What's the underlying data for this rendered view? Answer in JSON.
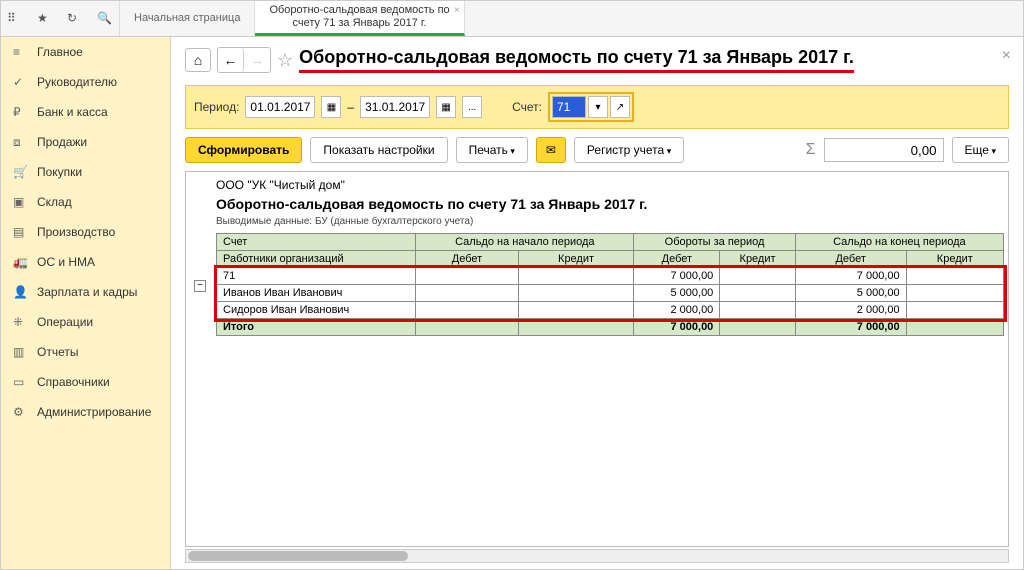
{
  "tabs": [
    {
      "label": "Начальная страница",
      "active": false
    },
    {
      "label1": "Оборотно-сальдовая ведомость по",
      "label2": "счету 71 за Январь 2017 г.",
      "active": true
    }
  ],
  "sidebar": [
    {
      "label": "Главное",
      "icon": "menu-icon"
    },
    {
      "label": "Руководителю",
      "icon": "chart-icon"
    },
    {
      "label": "Банк и касса",
      "icon": "ruble-icon"
    },
    {
      "label": "Продажи",
      "icon": "bag-icon"
    },
    {
      "label": "Покупки",
      "icon": "cart-icon"
    },
    {
      "label": "Склад",
      "icon": "box-icon"
    },
    {
      "label": "Производство",
      "icon": "factory-icon"
    },
    {
      "label": "ОС и НМА",
      "icon": "truck-icon"
    },
    {
      "label": "Зарплата и кадры",
      "icon": "user-icon"
    },
    {
      "label": "Операции",
      "icon": "ops-icon"
    },
    {
      "label": "Отчеты",
      "icon": "report-icon"
    },
    {
      "label": "Справочники",
      "icon": "book-icon"
    },
    {
      "label": "Администрирование",
      "icon": "gear-icon"
    }
  ],
  "page_title": "Оборотно-сальдовая ведомость по счету 71 за Январь 2017 г.",
  "period": {
    "label": "Период:",
    "from": "01.01.2017",
    "dash": "–",
    "to": "31.01.2017",
    "ellipsis": "...",
    "account_label": "Счет:",
    "account": "71"
  },
  "toolbar": {
    "form": "Сформировать",
    "settings": "Показать настройки",
    "print": "Печать",
    "register": "Регистр учета",
    "sum": "0,00",
    "more": "Еще"
  },
  "report": {
    "org": "ООО \"УК \"Чистый дом\"",
    "title": "Оборотно-сальдовая ведомость по счету 71 за Январь 2017 г.",
    "meta": "Выводимые данные: БУ (данные бухгалтерского учета)",
    "headers": {
      "account": "Счет",
      "subrow": "Работники организаций",
      "begin": "Сальдо на начало периода",
      "turnover": "Обороты за период",
      "end": "Сальдо на конец периода",
      "debit": "Дебет",
      "credit": "Кредит"
    },
    "rows": [
      {
        "name": "71",
        "t_debit": "7 000,00",
        "e_debit": "7 000,00"
      },
      {
        "name": "Иванов Иван Иванович",
        "t_debit": "5 000,00",
        "e_debit": "5 000,00"
      },
      {
        "name": "Сидоров Иван Иванович",
        "t_debit": "2 000,00",
        "e_debit": "2 000,00"
      }
    ],
    "total": {
      "name": "Итого",
      "t_debit": "7 000,00",
      "e_debit": "7 000,00"
    }
  }
}
